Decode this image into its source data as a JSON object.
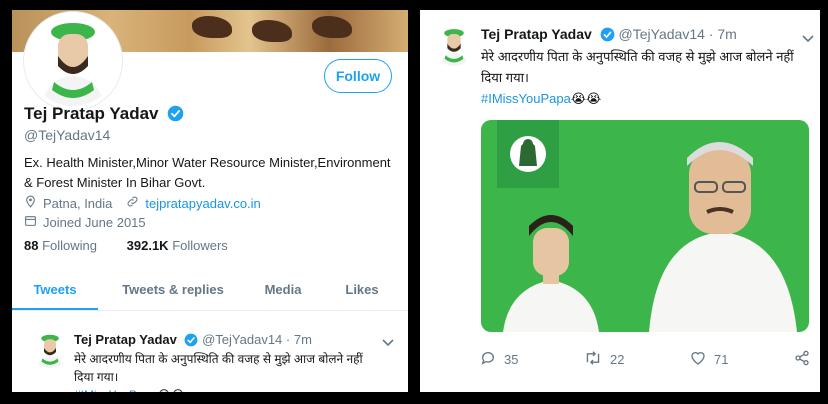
{
  "profile": {
    "follow_label": "Follow",
    "name": "Tej Pratap Yadav",
    "handle": "@TejYadav14",
    "bio": "Ex. Health Minister,Minor Water Resource Minister,Environment & Forest Minister In Bihar Govt.",
    "location": "Patna, India",
    "website": "tejpratapyadav.co.in",
    "joined": "Joined June 2015",
    "following_count": "88",
    "following_label": "Following",
    "followers_count": "392.1K",
    "followers_label": "Followers"
  },
  "tabs": [
    {
      "label": "Tweets"
    },
    {
      "label": "Tweets & replies"
    },
    {
      "label": "Media"
    },
    {
      "label": "Likes"
    }
  ],
  "tweet": {
    "name": "Tej Pratap Yadav",
    "handle": "@TejYadav14",
    "dot": "·",
    "time": "7m",
    "text_line1": "मेरे आदरणीय पिता के अनुपस्थिति की वजह से मुझे आज बोलने नहीं",
    "text_line2": "दिया गया।",
    "hashtag": "#IMissYouPapa",
    "emoji": "😭😭"
  },
  "actions": {
    "replies": "35",
    "retweets": "22",
    "likes": "71"
  },
  "colors": {
    "accent": "#1da1f2",
    "green": "#3cb54a",
    "muted": "#657786"
  }
}
